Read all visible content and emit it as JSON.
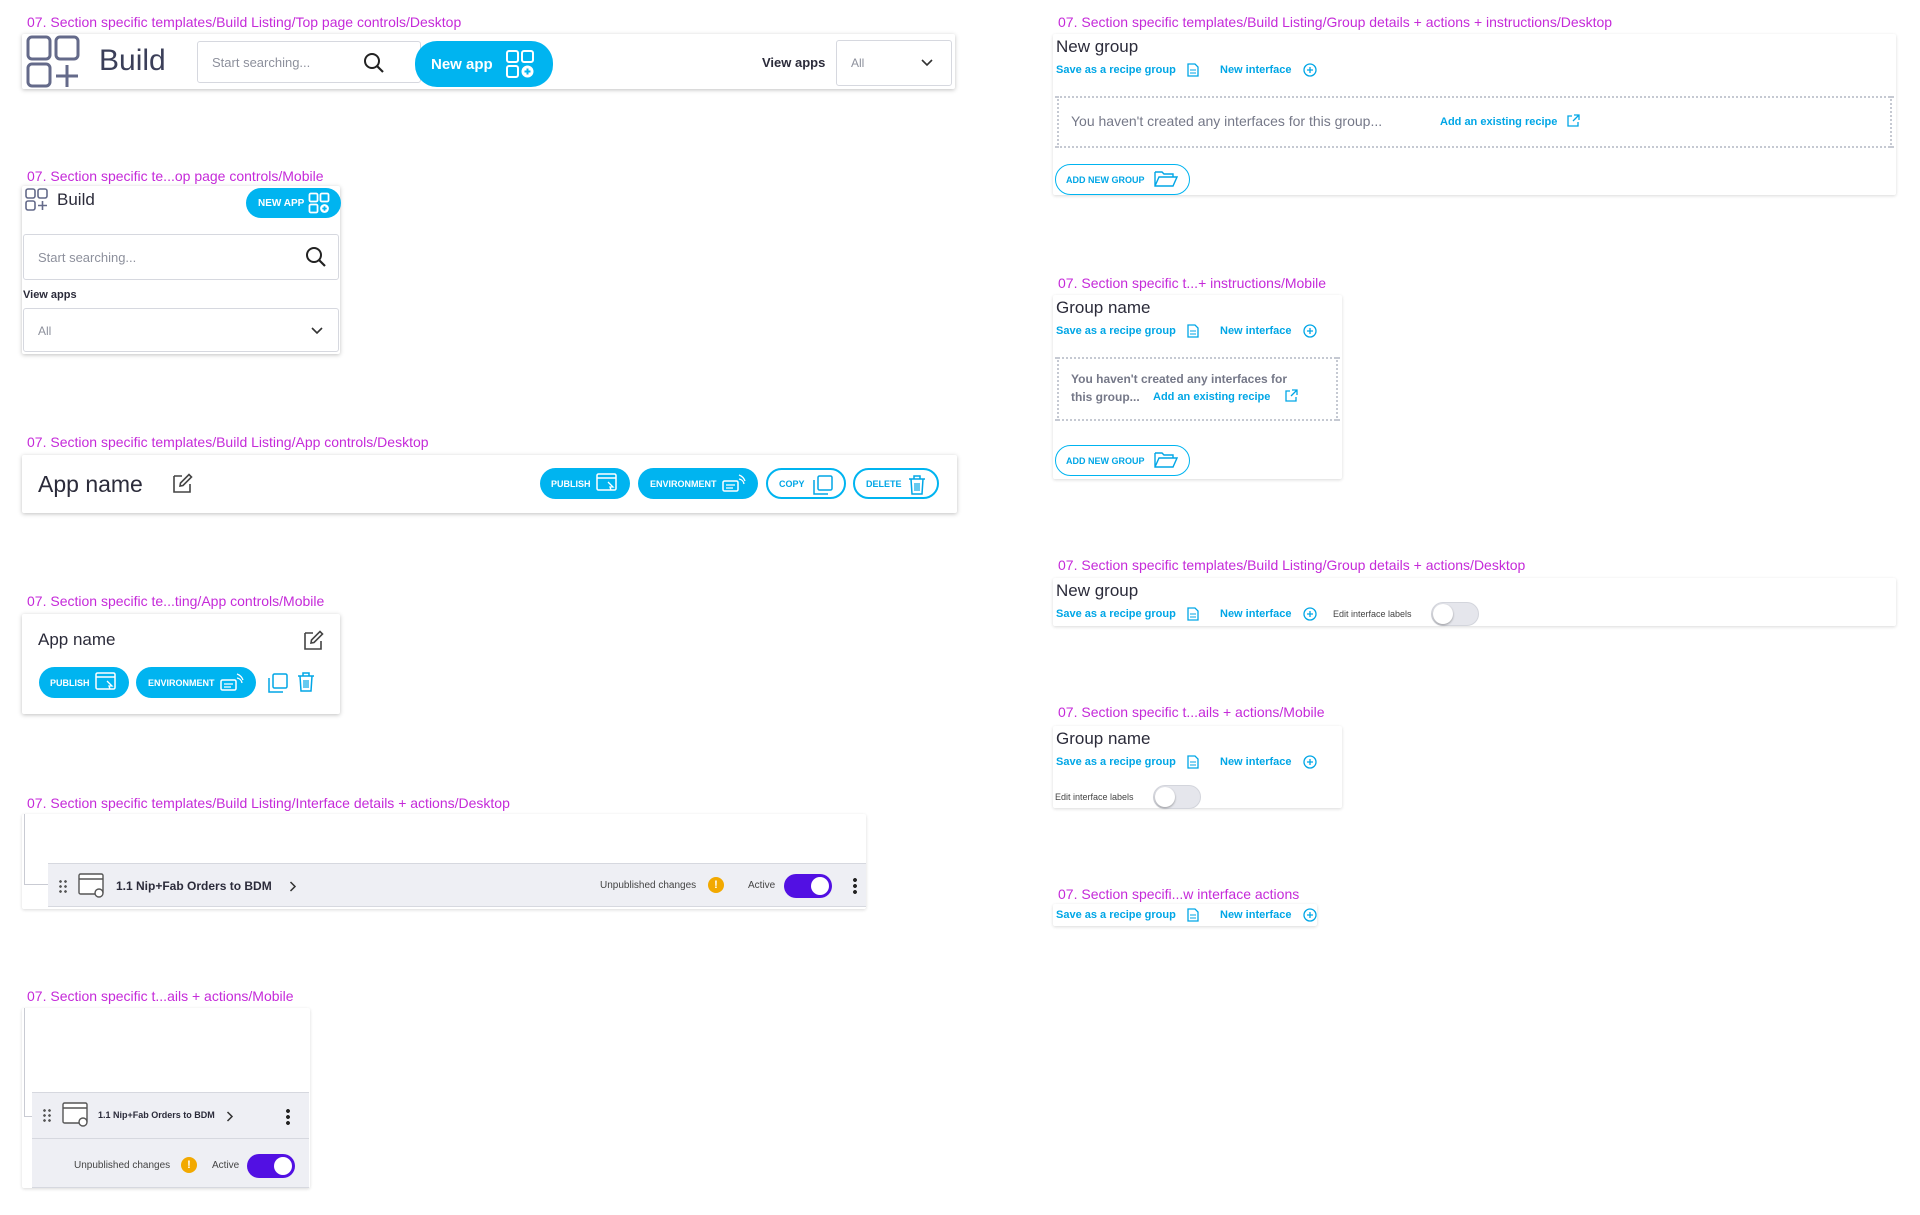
{
  "frames": {
    "f1": "07. Section specific templates/Build Listing/Top page controls/Desktop",
    "f2": "07. Section specific te...op page controls/Mobile",
    "f3": "07. Section specific templates/Build Listing/App controls/Desktop",
    "f4": "07. Section specific te...ting/App controls/Mobile",
    "f5": "07. Section specific templates/Build Listing/Interface details + actions/Desktop",
    "f6": "07. Section specific t...ails + actions/Mobile",
    "f7": "07. Section specific templates/Build Listing/Group details + actions + instructions/Desktop",
    "f8": "07. Section specific t...+ instructions/Mobile",
    "f9": "07. Section specific templates/Build Listing/Group details + actions/Desktop",
    "f10": "07. Section specific t...ails + actions/Mobile",
    "f11": "07. Section specifi...w interface actions"
  },
  "top_desktop": {
    "title": "Build",
    "search_placeholder": "Start searching...",
    "new_app": "New app",
    "view_apps_label": "View apps",
    "view_apps_value": "All"
  },
  "top_mobile": {
    "title": "Build",
    "new_app": "NEW APP",
    "search_placeholder": "Start searching...",
    "view_apps_label": "View apps",
    "view_apps_value": "All"
  },
  "app_desktop": {
    "name": "App name",
    "publish": "PUBLISH",
    "environment": "ENVIRONMENT",
    "copy": "COPY",
    "delete": "DELETE"
  },
  "app_mobile": {
    "name": "App name",
    "publish": "PUBLISH",
    "environment": "ENVIRONMENT"
  },
  "interface_desktop": {
    "name": "1.1 Nip+Fab Orders to BDM",
    "unpublished": "Unpublished changes",
    "warn": "!",
    "active": "Active"
  },
  "interface_mobile": {
    "name": "1.1 Nip+Fab Orders to BDM",
    "unpublished": "Unpublished changes",
    "warn": "!",
    "active": "Active"
  },
  "group_instr_desktop": {
    "title": "New group",
    "save_recipe": "Save as a recipe group",
    "new_interface": "New interface",
    "empty_text": "You haven't created any interfaces for this group...",
    "add_existing": "Add an existing recipe",
    "add_new_group": "ADD NEW GROUP"
  },
  "group_instr_mobile": {
    "title": "Group name",
    "save_recipe": "Save as a recipe group",
    "new_interface": "New interface",
    "empty_line1": "You haven't created any interfaces for",
    "empty_line2": "this group...",
    "add_existing": "Add an existing recipe",
    "add_new_group": "ADD NEW GROUP"
  },
  "group_desktop": {
    "title": "New group",
    "save_recipe": "Save as a recipe group",
    "new_interface": "New interface",
    "edit_labels": "Edit interface labels"
  },
  "group_mobile": {
    "title": "Group name",
    "save_recipe": "Save as a recipe group",
    "new_interface": "New interface",
    "edit_labels": "Edit interface labels"
  },
  "new_interface_actions": {
    "save_recipe": "Save as a recipe group",
    "new_interface": "New interface"
  },
  "colors": {
    "accent": "#00b4f0",
    "label": "#c52ad9",
    "toggle_on": "#5210e3",
    "warning": "#f2a900"
  }
}
